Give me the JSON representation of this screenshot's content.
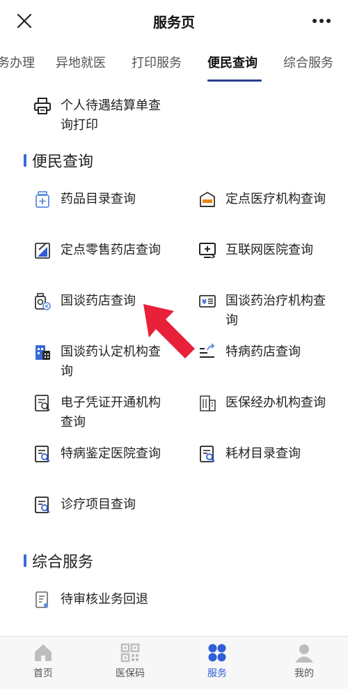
{
  "header": {
    "title": "服务页"
  },
  "tabs": [
    {
      "label": "务办理",
      "active": false
    },
    {
      "label": "异地就医",
      "active": false
    },
    {
      "label": "打印服务",
      "active": false
    },
    {
      "label": "便民查询",
      "active": true
    },
    {
      "label": "综合服务",
      "active": false
    }
  ],
  "print_section": {
    "items": [
      {
        "label": "个人待遇结算单查询打印",
        "icon": "printer-icon"
      }
    ]
  },
  "convenience_section": {
    "title": "便民查询",
    "items": [
      {
        "label": "药品目录查询",
        "icon": "medicine-bottle-icon"
      },
      {
        "label": "定点医疗机构查询",
        "icon": "medical-institution-icon"
      },
      {
        "label": "定点零售药店查询",
        "icon": "retail-pharmacy-icon"
      },
      {
        "label": "互联网医院查询",
        "icon": "internet-hospital-icon"
      },
      {
        "label": "国谈药店查询",
        "icon": "negotiated-pharmacy-icon"
      },
      {
        "label": "国谈药治疗机构查询",
        "icon": "yuan-payment-icon"
      },
      {
        "label": "国谈药认定机构查询",
        "icon": "building-blue-icon"
      },
      {
        "label": "特病药店查询",
        "icon": "share-list-icon"
      },
      {
        "label": "电子凭证开通机构查询",
        "icon": "document-search-icon"
      },
      {
        "label": "医保经办机构查询",
        "icon": "office-building-icon"
      },
      {
        "label": "特病鉴定医院查询",
        "icon": "document-search-icon"
      },
      {
        "label": "耗材目录查询",
        "icon": "document-search-icon"
      },
      {
        "label": "诊疗项目查询",
        "icon": "document-search-icon"
      }
    ]
  },
  "general_section": {
    "title": "综合服务",
    "items": [
      {
        "label": "待审核业务回退",
        "icon": "document-pending-icon"
      }
    ]
  },
  "bottom_nav": [
    {
      "label": "首页",
      "icon": "home-icon",
      "active": false
    },
    {
      "label": "医保码",
      "icon": "qr-code-icon",
      "active": false
    },
    {
      "label": "服务",
      "icon": "service-grid-icon",
      "active": true
    },
    {
      "label": "我的",
      "icon": "user-icon",
      "active": false
    }
  ],
  "colors": {
    "accent_blue": "#2f5ed8",
    "tab_underline": "#2a3f8f",
    "annotation_red": "#e8203a"
  }
}
